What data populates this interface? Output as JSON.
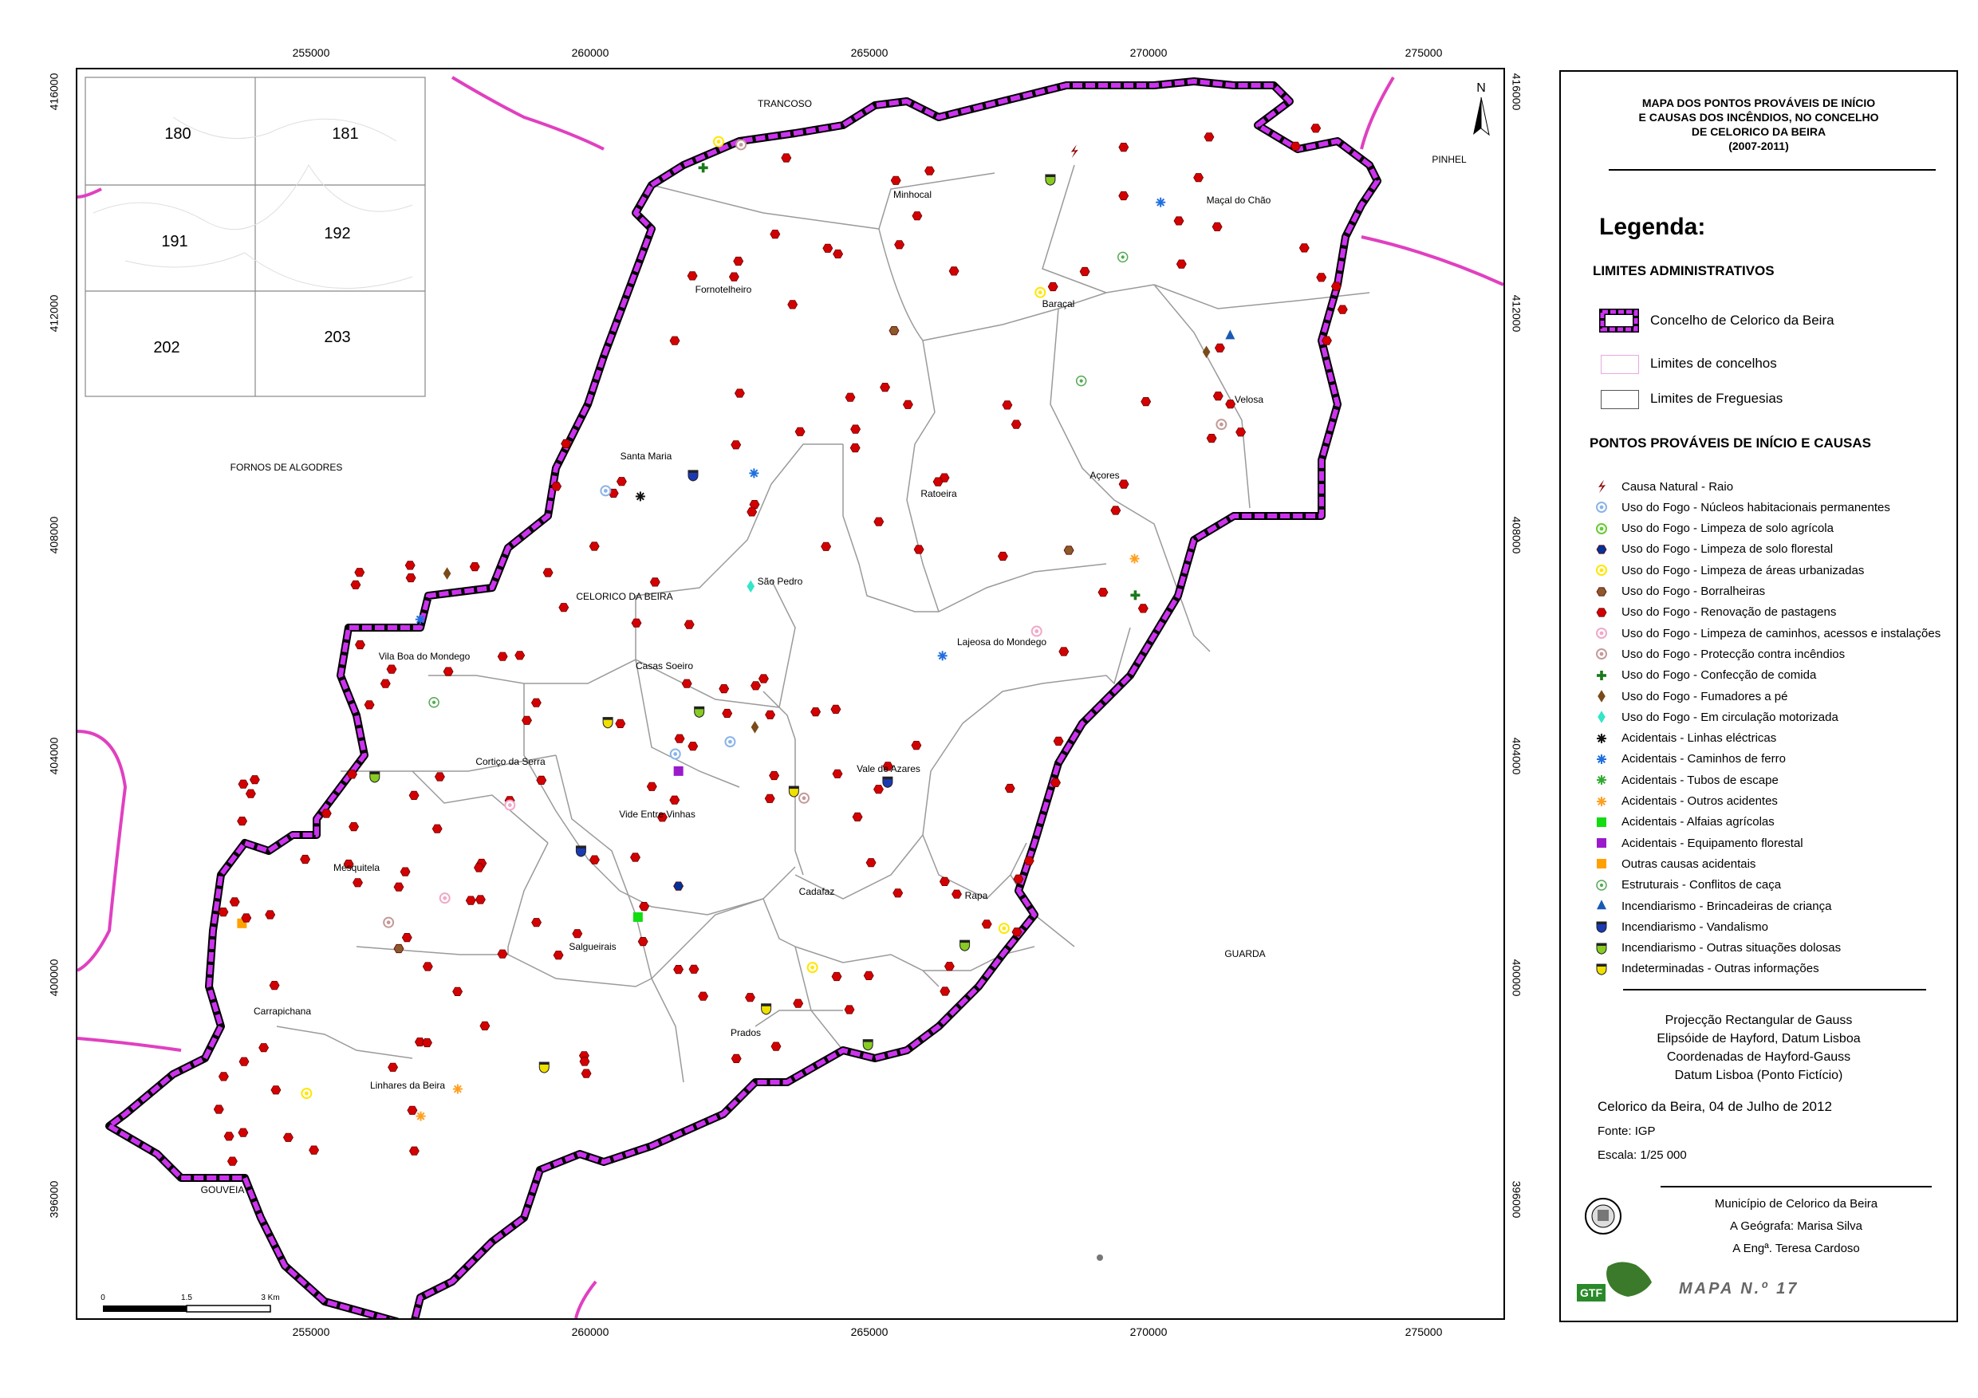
{
  "title_lines": [
    "MAPA DOS  PONTOS PROVÁVEIS DE INÍCIO",
    "E CAUSAS DOS INCÊNDIOS, NO CONCELHO",
    "DE CELORICO DA BEIRA",
    "(2007-2011)"
  ],
  "x_ticks": [
    "255000",
    "260000",
    "265000",
    "270000",
    "275000"
  ],
  "y_ticks": [
    "416000",
    "412000",
    "408000",
    "404000",
    "400000",
    "396000"
  ],
  "index_sheets": [
    "180",
    "181",
    "191",
    "192",
    "202",
    "203"
  ],
  "outer_places": [
    "TRANCOSO",
    "PINHEL",
    "FORNOS DE ALGODRES",
    "GUARDA",
    "GOUVEIA"
  ],
  "parishes": [
    "Minhocal",
    "Maçal do Chão",
    "Fornotelheiro",
    "Baraçal",
    "Velosa",
    "Santa Maria",
    "Ratoeira",
    "Açores",
    "São Pedro",
    "CELORICO DA BEIRA",
    "Casas Soeiro",
    "Lajeosa do Mondego",
    "Vila Boa do Mondego",
    "Cortiço da Serra",
    "Vale de Azares",
    "Vide Entre Vinhas",
    "Mesquitela",
    "Cadafaz",
    "Rapa",
    "Salgueirais",
    "Carrapichana",
    "Prados",
    "Linhares da Beira"
  ],
  "scale_bar": {
    "labels": [
      "0",
      "1.5",
      "3 Km"
    ]
  },
  "north_label": "N",
  "legend": {
    "heading": "Legenda:",
    "admin_title": "LIMITES ADMINISTRATIVOS",
    "admin_items": [
      "Concelho de Celorico da Beira",
      "Limites de concelhos",
      "Limites de Freguesias"
    ],
    "points_title": "PONTOS PROVÁVEIS DE INÍCIO E CAUSAS",
    "items": [
      {
        "label": "Causa Natural - Raio",
        "color": "#8b0000",
        "shape": "bolt"
      },
      {
        "label": "Uso do Fogo - Núcleos habitacionais permanentes",
        "color": "#8ab4e8",
        "shape": "dot"
      },
      {
        "label": "Uso do Fogo - Limpeza de solo agrícola",
        "color": "#66cc33",
        "shape": "dot"
      },
      {
        "label": "Uso do Fogo - Limpeza de solo florestal",
        "color": "#003399",
        "shape": "hex"
      },
      {
        "label": "Uso do Fogo - Limpeza de áreas urbanizadas",
        "color": "#ffe600",
        "shape": "dot"
      },
      {
        "label": "Uso do Fogo - Borralheiras",
        "color": "#8b5a2b",
        "shape": "hex"
      },
      {
        "label": "Uso do Fogo - Renovação de pastagens",
        "color": "#d40000",
        "shape": "hex"
      },
      {
        "label": "Uso do Fogo - Limpeza de caminhos, acessos e instalações",
        "color": "#f0a8c8",
        "shape": "dot"
      },
      {
        "label": "Uso do Fogo - Protecção contra incêndios",
        "color": "#c49a9a",
        "shape": "dot"
      },
      {
        "label": "Uso do Fogo - Confecção de comida",
        "color": "#1a7a1a",
        "shape": "plus"
      },
      {
        "label": "Uso do Fogo - Fumadores a pé",
        "color": "#7a4a1a",
        "shape": "diamond"
      },
      {
        "label": "Uso do Fogo - Em circulação motorizada",
        "color": "#33e6c8",
        "shape": "diamond"
      },
      {
        "label": "Acidentais - Linhas eléctricas",
        "color": "#111111",
        "shape": "star"
      },
      {
        "label": "Acidentais - Caminhos de ferro",
        "color": "#1f6fe0",
        "shape": "star"
      },
      {
        "label": "Acidentais - Tubos de escape",
        "color": "#33aa33",
        "shape": "star"
      },
      {
        "label": "Acidentais - Outros acidentes",
        "color": "#ffa020",
        "shape": "star"
      },
      {
        "label": "Acidentais - Alfaias agrícolas",
        "color": "#11dd11",
        "shape": "square"
      },
      {
        "label": "Acidentais - Equipamento florestal",
        "color": "#9a1acc",
        "shape": "square"
      },
      {
        "label": "Outras causas acidentais",
        "color": "#ffa000",
        "shape": "square"
      },
      {
        "label": "Estruturais - Conflitos de caça",
        "color": "#55aa55",
        "shape": "target"
      },
      {
        "label": "Incendiarismo - Brincadeiras de criança",
        "color": "#1a5ab5",
        "shape": "triangle"
      },
      {
        "label": "Incendiarismo - Vandalismo",
        "color": "#1a3ab5",
        "shape": "shield"
      },
      {
        "label": "Incendiarismo - Outras situações dolosas",
        "color": "#88cc22",
        "shape": "shield"
      },
      {
        "label": "Indeterminadas - Outras informações",
        "color": "#f0e000",
        "shape": "shield"
      }
    ]
  },
  "projection_lines": [
    "Projecção Rectangular de Gauss",
    "Elipsóide de Hayford, Datum Lisboa",
    "Coordenadas de Hayford-Gauss",
    "Datum Lisboa (Ponto Fictício)"
  ],
  "date_line": "Celorico da Beira, 04 de Julho de 2012",
  "source": "Fonte: IGP",
  "scale": "Escala: 1/25 000",
  "credits": [
    "Município de Celorico da Beira",
    "A Geógrafa: Marisa Silva",
    "A Engª. Teresa Cardoso"
  ],
  "logo_text": "GTF",
  "map_number": "MAPA N.º 17",
  "colors": {
    "county_border": "#cc33ee",
    "concelho_lines": "#e040c0",
    "freguesia_lines": "#999999",
    "points_red": "#d40000"
  }
}
